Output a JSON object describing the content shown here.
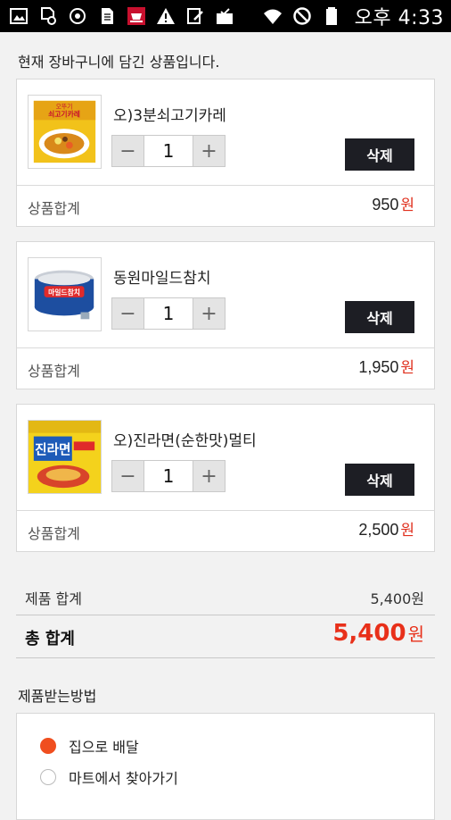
{
  "status_bar": {
    "time": "오후 4:33",
    "left_icons": [
      "gallery-icon",
      "file-sync-icon",
      "sync-circle-icon",
      "sim-card-icon",
      "shop-app-icon",
      "warning-icon",
      "note-edit-icon",
      "mail-check-icon"
    ],
    "right_icons": [
      "wifi-icon",
      "do-not-disturb-icon",
      "battery-icon"
    ]
  },
  "cart": {
    "notice": "현재 장바구니에 담긴 상품입니다.",
    "items": [
      {
        "name": "오)3분쇠고기카레",
        "qty": "1",
        "subtotal_label": "상품합계",
        "subtotal": "950",
        "currency": "원",
        "delete_label": "삭제",
        "minus": "−",
        "plus": "+",
        "image": "curry-product-image"
      },
      {
        "name": "동원마일드참치",
        "qty": "1",
        "subtotal_label": "상품합계",
        "subtotal": "1,950",
        "currency": "원",
        "delete_label": "삭제",
        "minus": "−",
        "plus": "+",
        "image": "tuna-can-product-image"
      },
      {
        "name": "오)진라면(순한맛)멀티",
        "qty": "1",
        "subtotal_label": "상품합계",
        "subtotal": "2,500",
        "currency": "원",
        "delete_label": "삭제",
        "minus": "−",
        "plus": "+",
        "image": "ramen-pack-product-image"
      }
    ],
    "product_total_label": "제품 합계",
    "product_total": "5,400원",
    "grand_total_label": "총 합계",
    "grand_total": "5,400",
    "grand_total_currency": "원"
  },
  "delivery": {
    "title": "제품받는방법",
    "options": [
      {
        "label": "집으로 배달",
        "selected": true
      },
      {
        "label": "마트에서 찾아가기",
        "selected": false
      }
    ]
  },
  "colors": {
    "accent": "#e8301a",
    "radio_selected": "#f04e1f",
    "delete_button": "#1d1e24"
  }
}
